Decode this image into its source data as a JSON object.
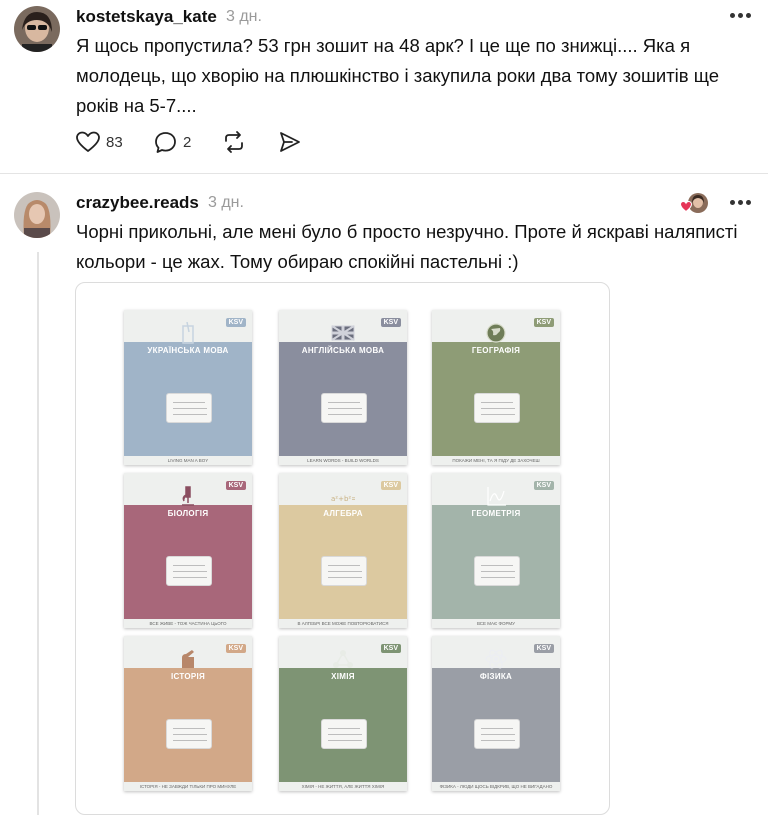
{
  "post1": {
    "username": "kostetskaya_kate",
    "time": "3 дн.",
    "text_line1": "Я щось пропустила? 53 грн зошит на 48 арк? І це ще по знижці.... Яка я",
    "text_line2": "молодець, що хворію на плюшкінство і закупила роки два тому зошитів ще",
    "text_line3": "років на 5-7....",
    "likes": "83",
    "replies": "2"
  },
  "post2": {
    "username": "crazybee.reads",
    "time": "3 дн.",
    "text_line1": "Чорні прикольні, але мені було б просто незручно. Проте й яскраві наляписті",
    "text_line2": "кольори - це жах. Тому обираю спокійні пастельні :)"
  },
  "notebooks": [
    {
      "subject": "УКРАЇНСЬКА МОВА",
      "color": "#a0b4c8",
      "icon": "glass-icon",
      "slogan": "LIVING MAN A BOY"
    },
    {
      "subject": "АНГЛІЙСЬКА МОВА",
      "color": "#8a8e9e",
      "icon": "uk-flag-icon",
      "slogan": "LEARN WORDS - BUILD WORLDS"
    },
    {
      "subject": "ГЕОГРАФІЯ",
      "color": "#8e9c76",
      "icon": "globe-icon",
      "slogan": "ПОКАЖИ МЕНІ, ТА Я ПІДУ ДЕ ЗАХОЧЕШ"
    },
    {
      "subject": "БІОЛОГІЯ",
      "color": "#a8677a",
      "icon": "microscope-icon",
      "slogan": "ВСЕ ЖИВЕ - ТОЖ ЧАСТИНА ЦЬОГО"
    },
    {
      "subject": "АЛГЕБРА",
      "color": "#dcc9a0",
      "icon": "formula-icon",
      "slogan": "В АЛГЕБРІ ВСЕ МОЖЕ ПОВТОРЮВАТИСЯ"
    },
    {
      "subject": "ГЕОМЕТРІЯ",
      "color": "#a3b4aa",
      "icon": "graph-icon",
      "slogan": "ВСЕ МАЄ ФОРМУ"
    },
    {
      "subject": "ІСТОРІЯ",
      "color": "#d2a888",
      "icon": "hand-icon",
      "slogan": "ІСТОРІЯ - НЕ ЗАВЖДИ ТІЛЬКИ ПРО МИНУЛЕ"
    },
    {
      "subject": "ХІМІЯ",
      "color": "#7e9474",
      "icon": "molecule-icon",
      "slogan": "ХІМІЯ - НЕ ЖИТТЯ, АЛЕ ЖИТТЯ ХІМІЯ"
    },
    {
      "subject": "ФІЗИКА",
      "color": "#9a9ea6",
      "icon": "atom-icon",
      "slogan": "ФІЗИКА - ЛЮДИ ЩОСЬ ВІДКРИВ, ЩО НЕ ВИГАДАНО"
    }
  ],
  "logo_text": "KSV",
  "colors": {
    "accent_heart": "#e53558",
    "border": "#dcdcdc"
  }
}
